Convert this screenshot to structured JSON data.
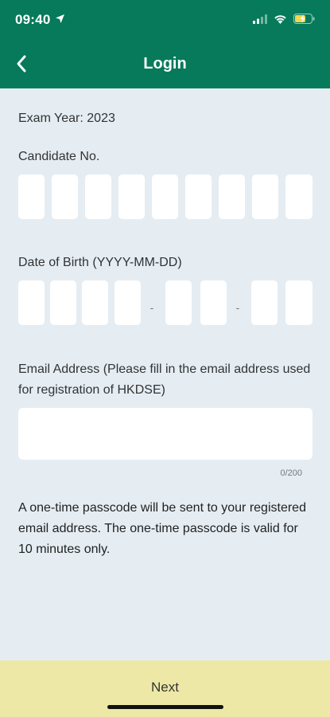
{
  "status_bar": {
    "time": "09:40",
    "icons": [
      "location-arrow-icon",
      "cellular-signal-icon",
      "wifi-icon",
      "battery-charging-icon"
    ]
  },
  "nav": {
    "back_icon": "chevron-left-icon",
    "title": "Login"
  },
  "exam_year": {
    "text": "Exam Year: 2023"
  },
  "candidate": {
    "label": "Candidate No.",
    "digit_count": 9,
    "values": [
      "",
      "",
      "",
      "",
      "",
      "",
      "",
      "",
      ""
    ]
  },
  "dob": {
    "label": "Date of Birth (YYYY-MM-DD)",
    "separator": "-",
    "year": [
      "",
      "",
      "",
      ""
    ],
    "month": [
      "",
      ""
    ],
    "day": [
      "",
      ""
    ]
  },
  "email": {
    "label": "Email Address (Please fill in the email address used for registration of HKDSE)",
    "value": "",
    "placeholder": "",
    "counter": "0/200"
  },
  "notice": {
    "text": "A one-time passcode will be sent to your registered email address. The one-time passcode is valid for 10 minutes only."
  },
  "footer": {
    "next_label": "Next"
  },
  "colors": {
    "header": "#067a5a",
    "background": "#e5edf3",
    "footer": "#ede8a6",
    "input": "#ffffff"
  }
}
